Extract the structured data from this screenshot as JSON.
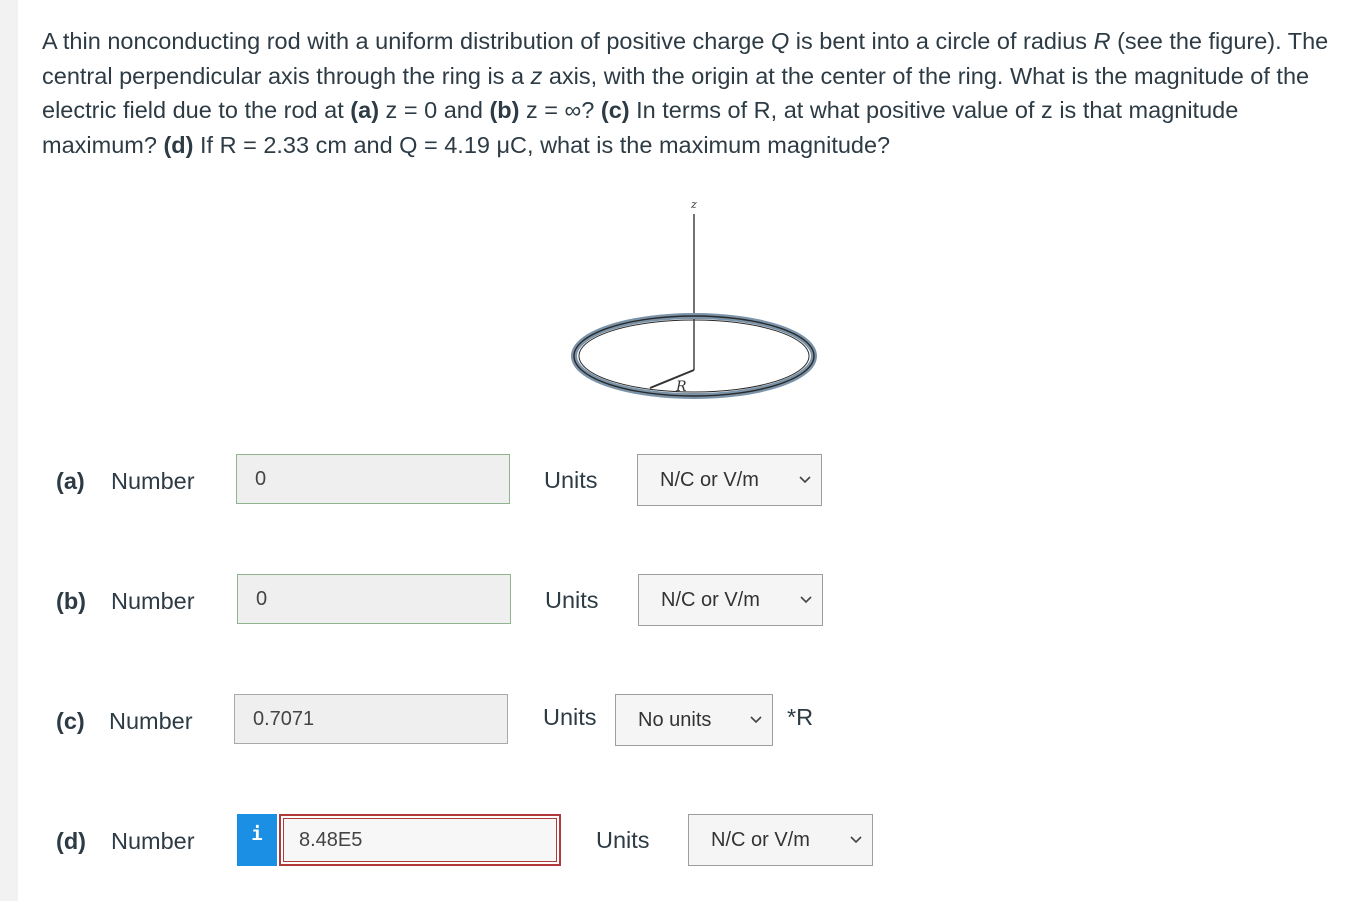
{
  "question": {
    "intro": "A thin nonconducting rod with a uniform distribution of positive charge ",
    "Q": "Q",
    "mid1": " is bent into a circle of radius ",
    "R": "R",
    "mid2": " (see the figure). The central perpendicular axis through the ring is a ",
    "z1": "z",
    "mid3": " axis, with the origin at the center of the ring. What is the magnitude of the electric field due to the rod at ",
    "a_label": "(a)",
    "a_expr": " z = 0 and ",
    "b_label": "(b)",
    "b_expr": " z = ∞? ",
    "c_label": "(c)",
    "c_text": " In terms of R, at what positive value of z is that magnitude maximum? ",
    "d_label": "(d)",
    "d_text": " If R = 2.33 cm and Q = 4.19 μC, what is the maximum magnitude?"
  },
  "figure": {
    "axis_label": "z",
    "radius_label": "R"
  },
  "rows": [
    {
      "part": "(a)",
      "number_label": "Number",
      "value": "0",
      "units_label": "Units",
      "unit": "N/C or V/m"
    },
    {
      "part": "(b)",
      "number_label": "Number",
      "value": "0",
      "units_label": "Units",
      "unit": "N/C or V/m"
    },
    {
      "part": "(c)",
      "number_label": "Number",
      "value": "0.7071",
      "units_label": "Units",
      "unit": "No units",
      "suffix": "*R"
    },
    {
      "part": "(d)",
      "number_label": "Number",
      "value": "8.48E5",
      "units_label": "Units",
      "unit": "N/C or V/m",
      "info": "i"
    }
  ]
}
